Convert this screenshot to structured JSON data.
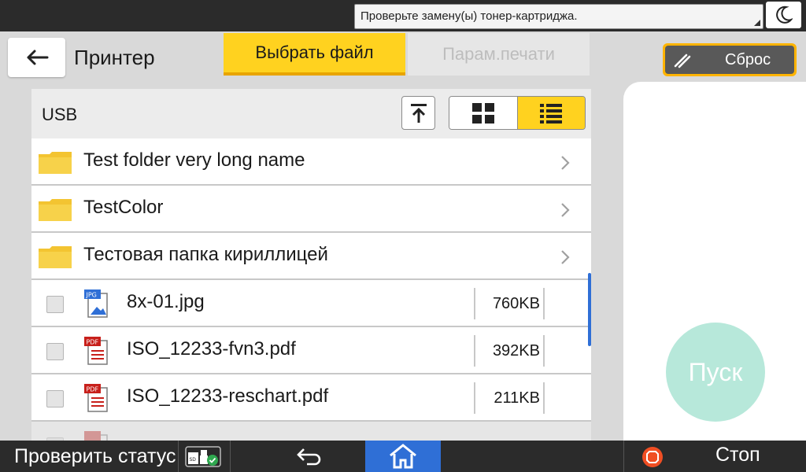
{
  "status_bar": {
    "alert_text": "Проверьте замену(ы) тонер-картриджа."
  },
  "header": {
    "app_title": "Принтер",
    "tabs": [
      {
        "label": "Выбрать файл",
        "state": "active"
      },
      {
        "label": "Парам.печати",
        "state": "disabled"
      }
    ],
    "reset_label": "Сброс"
  },
  "browser": {
    "path": "USB",
    "view_mode": "list",
    "folders": [
      {
        "name": "Test folder very long name"
      },
      {
        "name": "TestColor"
      },
      {
        "name": "Тестовая папка кириллицей"
      }
    ],
    "files": [
      {
        "name": "8x-01.jpg",
        "type": "JPG",
        "size": "760KB",
        "checked": false
      },
      {
        "name": "ISO_12233-fvn3.pdf",
        "type": "PDF",
        "size": "392KB",
        "checked": false
      },
      {
        "name": "ISO_12233-reschart.pdf",
        "type": "PDF",
        "size": "211KB",
        "checked": false
      }
    ]
  },
  "start_label": "Пуск",
  "bottom_bar": {
    "status_label": "Проверить статус",
    "stop_label": "Стоп"
  },
  "colors": {
    "accent_yellow": "#ffd21f",
    "reset_border": "#ffb400",
    "home_blue": "#2f6fd6",
    "start_button": "#b7e8da",
    "stop_icon": "#f04e23"
  }
}
